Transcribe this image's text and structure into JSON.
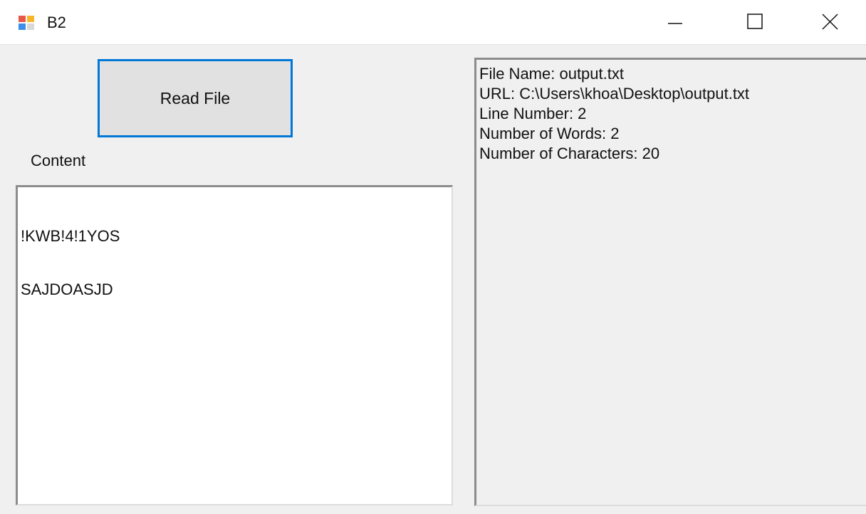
{
  "window": {
    "title": "B2",
    "icon": "winforms-app-icon",
    "controls": [
      "minimize-icon",
      "maximize-icon",
      "close-icon"
    ]
  },
  "read_button": {
    "label": "Read File"
  },
  "content": {
    "label": "Content",
    "lines": [
      "!KWB!4!1YOS",
      "SAJDOASJD"
    ]
  },
  "info": {
    "lines": [
      "File Name: output.txt",
      "URL: C:\\Users\\khoa\\Desktop\\output.txt",
      "Line Number: 2",
      "Number of Words: 2",
      "Number of Characters: 20"
    ]
  },
  "colors": {
    "focus_border": "#0078d7",
    "form_background": "#f0f0f0",
    "textbox_background": "#ffffff"
  }
}
